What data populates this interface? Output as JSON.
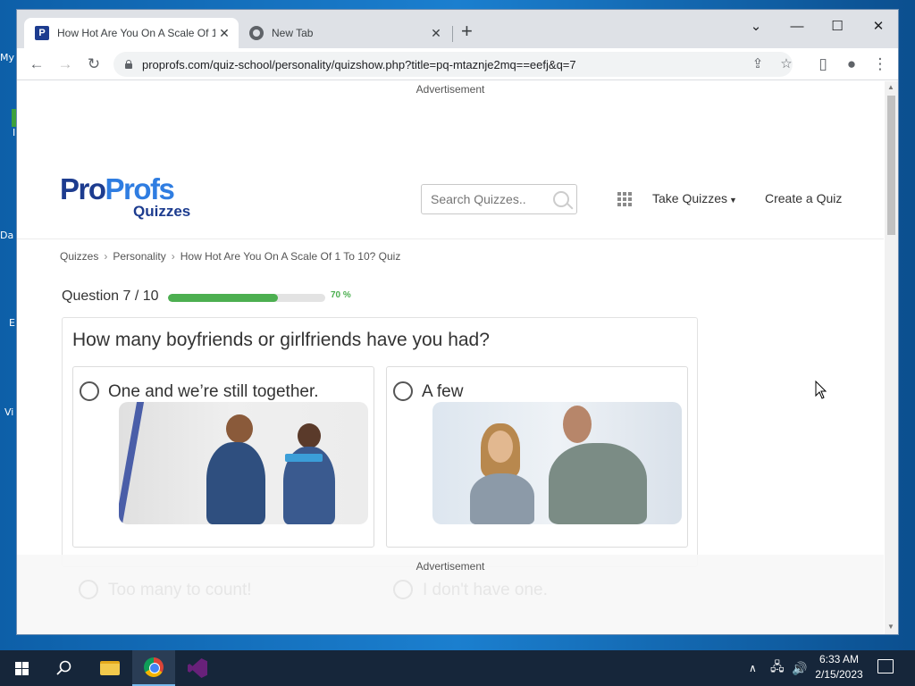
{
  "desktop": {
    "icons": [
      "My",
      "I",
      "Da",
      "E",
      "Vi"
    ]
  },
  "browser": {
    "tabs": [
      {
        "title": "How Hot Are You On A Scale Of 1 To 10? Quiz",
        "active": true
      },
      {
        "title": "New Tab",
        "active": false
      }
    ],
    "new_tab_symbol": "+",
    "url": "proprofs.com/quiz-school/personality/quizshow.php?title=pq-mtaznje2mq==eefj&q=7",
    "window_controls": {
      "dropdown": "⌄",
      "minimize": "—",
      "maximize": "☐",
      "close": "✕"
    }
  },
  "page": {
    "ad_top": "Advertisement",
    "logo": {
      "pro": "Pro",
      "profs": "Profs",
      "sub": "Quizzes"
    },
    "search_placeholder": "Search Quizzes..",
    "nav": {
      "take_quizzes": "Take Quizzes",
      "create_quiz": "Create a Quiz"
    },
    "breadcrumb": [
      "Quizzes",
      "Personality",
      "How Hot Are You On A Scale Of 1 To 10? Quiz"
    ],
    "breadcrumb_sep": "›",
    "question_count": "Question 7 / 10",
    "progress_percent": 70,
    "progress_label": "70 %",
    "question": "How many boyfriends or girlfriends have you had?",
    "options": [
      {
        "label": "One and we’re still together."
      },
      {
        "label": "A few"
      }
    ],
    "faded_options": [
      "Too many to count!",
      "I don't have one."
    ],
    "ad_bottom": "Advertisement"
  },
  "taskbar": {
    "time": "6:33 AM",
    "date": "2/15/2023"
  },
  "colors": {
    "brand_dark": "#1d3c8f",
    "brand_light": "#2f7de1",
    "progress": "#4caf50"
  }
}
